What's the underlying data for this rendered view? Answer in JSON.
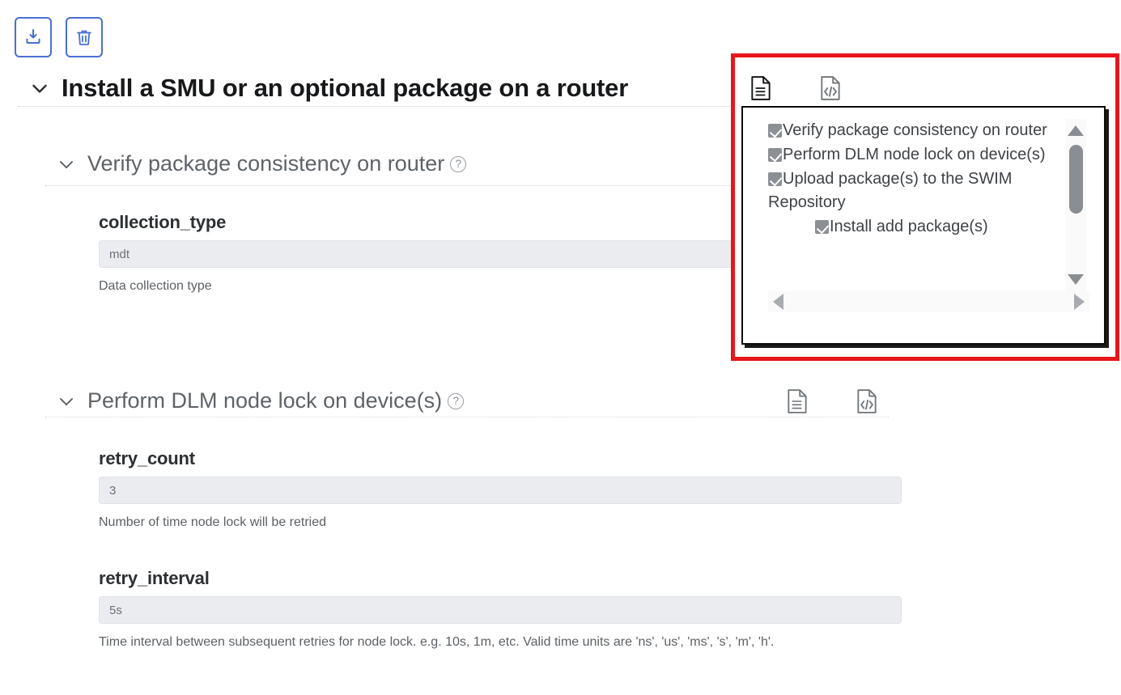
{
  "toolbar": {
    "download_label": "download-icon",
    "delete_label": "trash-icon"
  },
  "main_section": {
    "title": "Install a SMU or an optional package on a router",
    "expanded": true,
    "chevron": "chevron-down-icon"
  },
  "subsections": [
    {
      "title": "Verify package consistency on router",
      "help": "?",
      "chevron": "chevron-down-icon",
      "fields": [
        {
          "label": "collection_type",
          "value": "mdt",
          "hint": "Data collection type"
        }
      ]
    },
    {
      "title": "Perform DLM node lock on device(s)",
      "help": "?",
      "chevron": "chevron-down-icon",
      "doc_icon": "document-icon",
      "code_icon": "code-document-icon",
      "fields": [
        {
          "label": "retry_count",
          "value": "3",
          "hint": "Number of time node lock will be retried"
        },
        {
          "label": "retry_interval",
          "value": "5s",
          "hint": "Time interval between subsequent retries for node lock. e.g. 10s, 1m, etc. Valid time units are 'ns', 'us', 'ms', 's', 'm', 'h'."
        }
      ]
    }
  ],
  "popup": {
    "highlight_color": "#e8161a",
    "tabs": [
      {
        "name": "document-icon",
        "active": true
      },
      {
        "name": "code-document-icon",
        "active": false
      }
    ],
    "items": [
      {
        "label": "Verify package consistency on router",
        "checked": true,
        "indent": 0
      },
      {
        "label": "Perform DLM node lock on device(s)",
        "checked": true,
        "indent": 0
      },
      {
        "label": "Upload package(s) to the SWIM Repository",
        "checked": true,
        "indent": 0
      },
      {
        "label": "Install add package(s)",
        "checked": true,
        "indent": 1
      }
    ],
    "scrollbars": {
      "vertical": {
        "up": "triangle-up-icon",
        "down": "triangle-down-icon",
        "thumb": "scroll-thumb"
      },
      "horizontal": {
        "left": "triangle-left-icon",
        "right": "triangle-right-icon"
      }
    }
  }
}
